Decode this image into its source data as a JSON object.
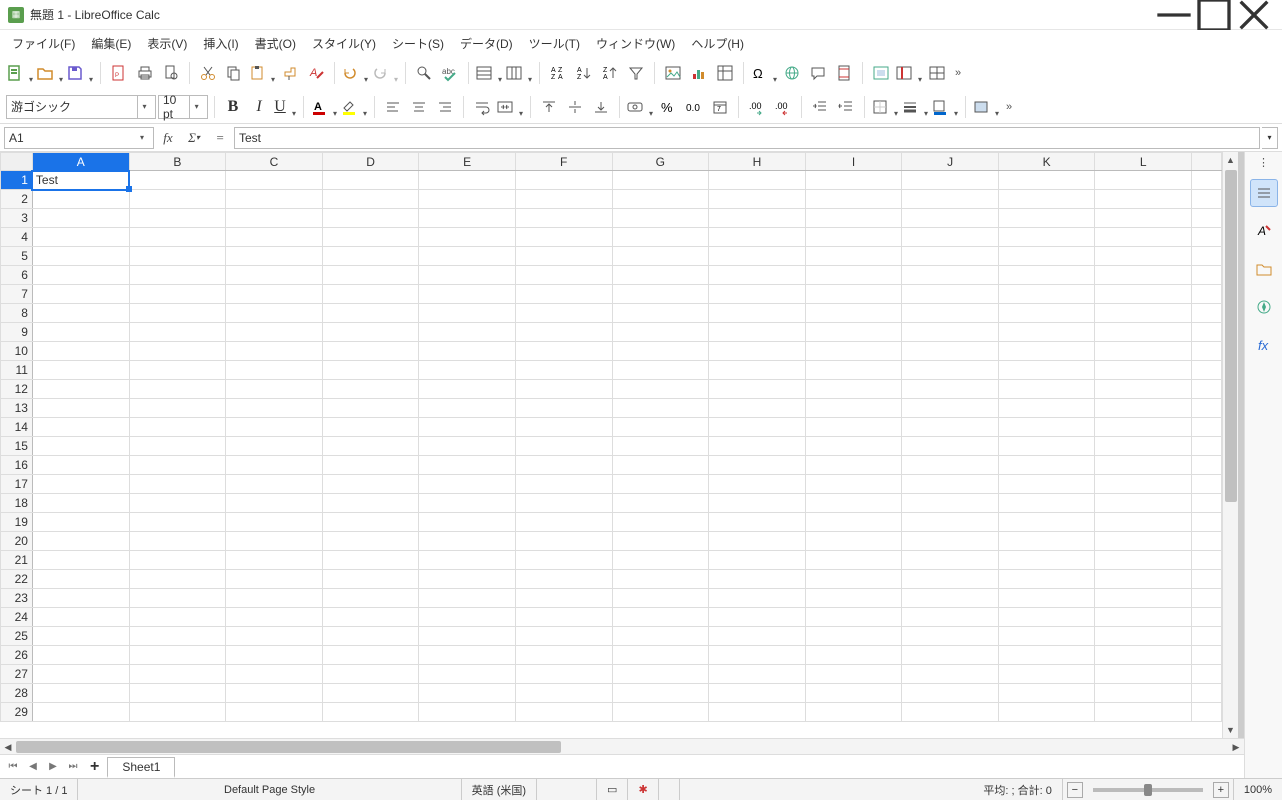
{
  "title": "無題 1 - LibreOffice Calc",
  "menu": {
    "file": "ファイル(F)",
    "edit": "編集(E)",
    "view": "表示(V)",
    "insert": "挿入(I)",
    "format": "書式(O)",
    "styles": "スタイル(Y)",
    "sheet": "シート(S)",
    "data": "データ(D)",
    "tools": "ツール(T)",
    "window": "ウィンドウ(W)",
    "help": "ヘルプ(H)"
  },
  "font": {
    "name": "游ゴシック",
    "size": "10 pt"
  },
  "cell_ref": "A1",
  "formula_value": "Test",
  "columns": [
    "A",
    "B",
    "C",
    "D",
    "E",
    "F",
    "G",
    "H",
    "I",
    "J",
    "K",
    "L"
  ],
  "rows_visible": 29,
  "selected_row": 1,
  "selected_col": "A",
  "cells": {
    "A1": "Test"
  },
  "sheet_tab": "Sheet1",
  "status": {
    "sheet_of": "シート 1 / 1",
    "page_style": "Default Page Style",
    "language": "英語 (米国)",
    "aggregate": "平均: ; 合計: 0",
    "zoom": "100%"
  }
}
